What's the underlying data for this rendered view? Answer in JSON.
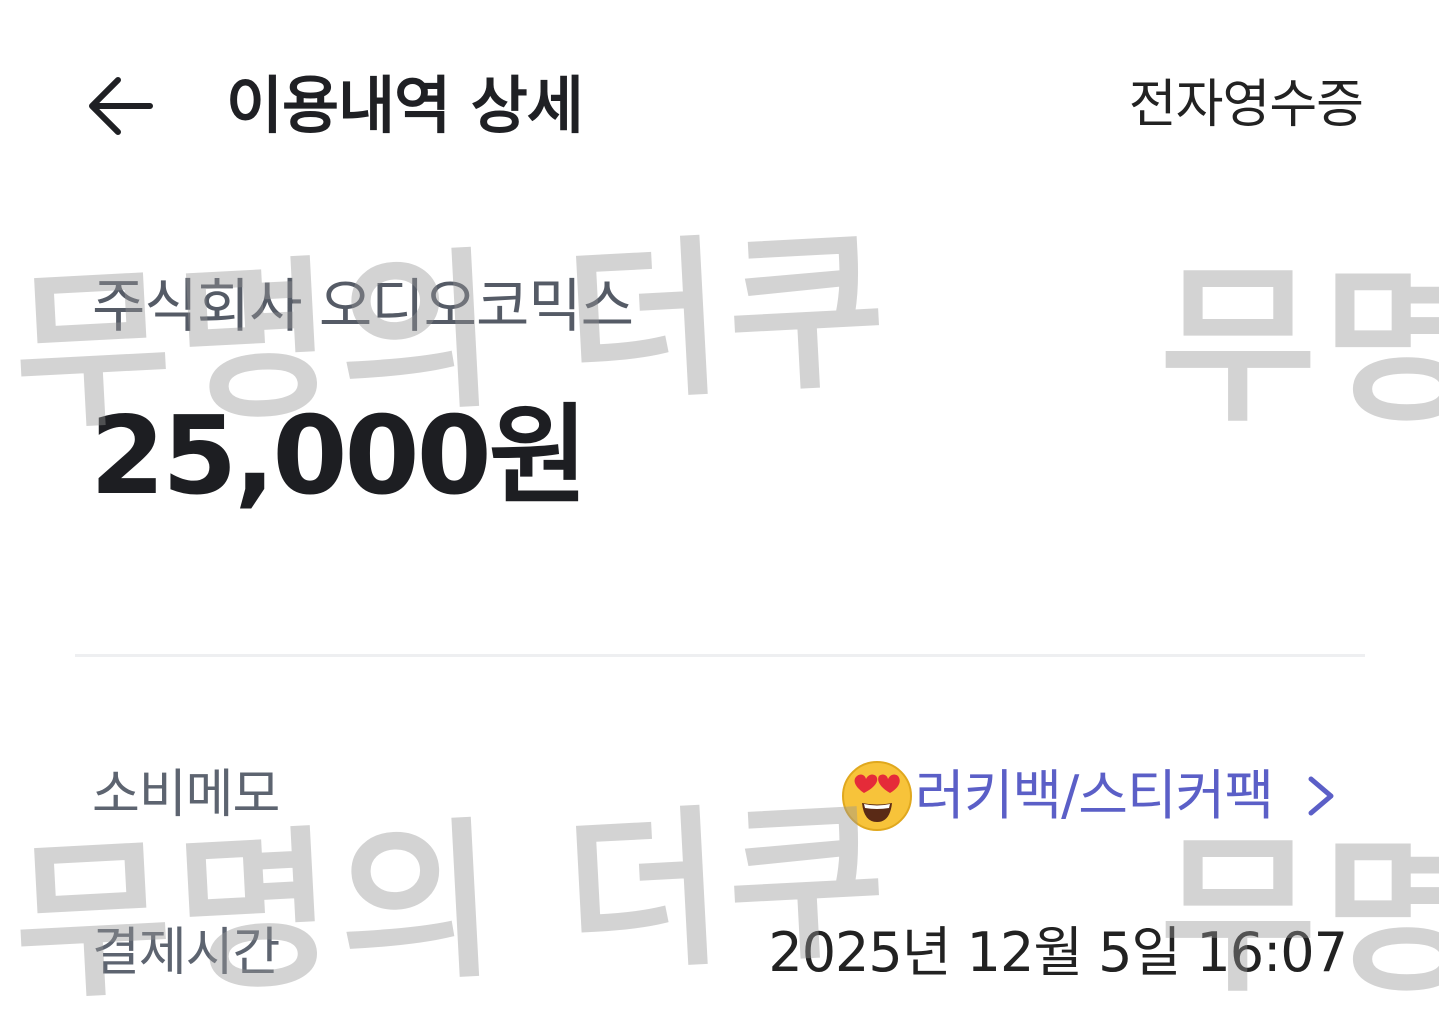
{
  "header": {
    "title": "이용내역 상세",
    "receipt_label": "전자영수증",
    "back_icon": "arrow-left-icon"
  },
  "summary": {
    "merchant": "주식회사 오디오코믹스",
    "amount": "25,000원"
  },
  "details": {
    "memo_label": "소비메모",
    "memo_emoji": "heart-eyes-emoji",
    "memo_value": "러키백/스티커팩",
    "memo_chevron": "chevron-right-icon",
    "time_label": "결제시간",
    "time_value": "2025년 12월 5일 16:07"
  },
  "watermark": {
    "text": "무명의 더쿠",
    "text_partial": "무명의"
  },
  "colors": {
    "accent": "#5b5fc7",
    "label": "#5d6470",
    "divider": "#eeeff1"
  }
}
